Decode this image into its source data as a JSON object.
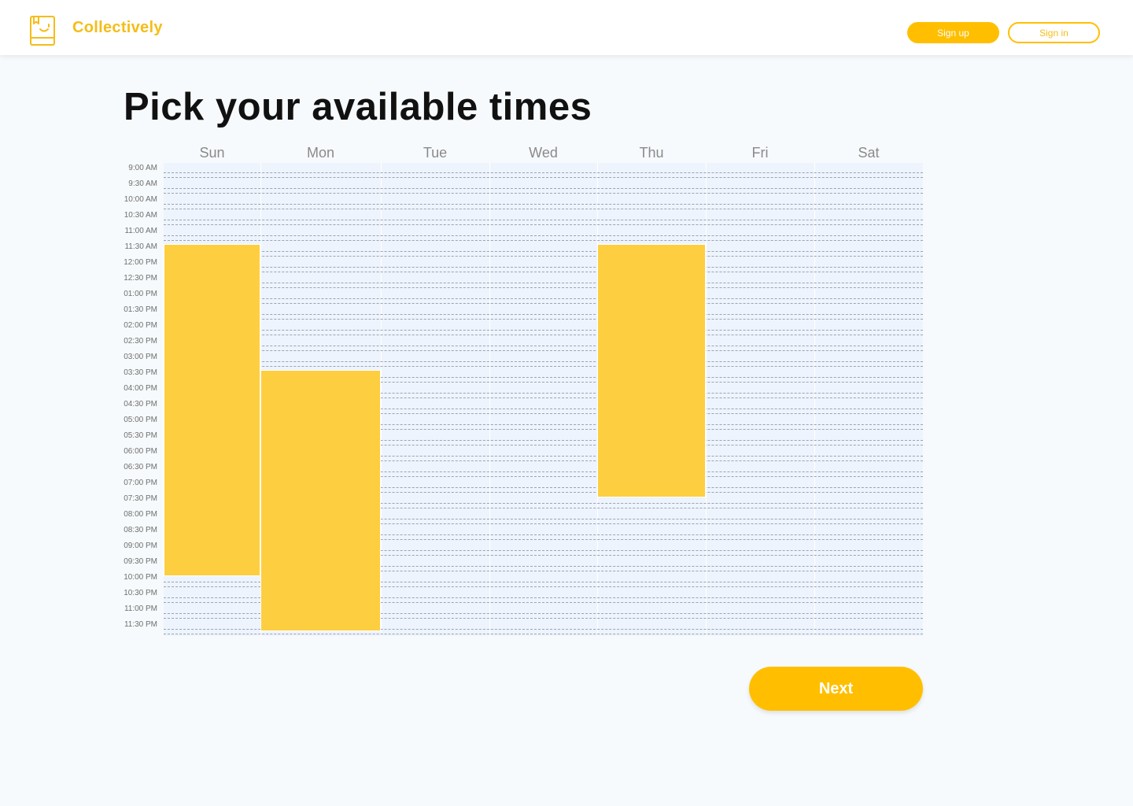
{
  "header": {
    "brand": "Collectively",
    "logo_icon": "book-smile-icon",
    "signup_label": "Sign up",
    "signin_label": "Sign in"
  },
  "page_title": "Pick your available times",
  "days": [
    "Sun",
    "Mon",
    "Tue",
    "Wed",
    "Thu",
    "Fri",
    "Sat"
  ],
  "times": [
    "9:00 AM",
    "9:30 AM",
    "10:00 AM",
    "10:30 AM",
    "11:00 AM",
    "11:30 AM",
    "12:00 PM",
    "12:30 PM",
    "01:00 PM",
    "01:30 PM",
    "02:00 PM",
    "02:30 PM",
    "03:00 PM",
    "03:30 PM",
    "04:00 PM",
    "04:30 PM",
    "05:00 PM",
    "05:30 PM",
    "06:00 PM",
    "06:30 PM",
    "07:00 PM",
    "07:30 PM",
    "08:00 PM",
    "08:30 PM",
    "09:00 PM",
    "09:30 PM",
    "10:00 PM",
    "10:30 PM",
    "11:00 PM",
    "11:30 PM"
  ],
  "selections": [
    {
      "day": "Sun",
      "start": "11:30 AM",
      "end": "10:00 PM"
    },
    {
      "day": "Mon",
      "start": "03:30 PM",
      "end": "11:30 PM"
    },
    {
      "day": "Thu",
      "start": "11:30 AM",
      "end": "07:30 PM"
    }
  ],
  "next_label": "Next",
  "colors": {
    "accent": "#ffbf00",
    "brand_text": "#f5bd17",
    "selection": "#fdce40",
    "grid_bg": "#eef4fd"
  }
}
